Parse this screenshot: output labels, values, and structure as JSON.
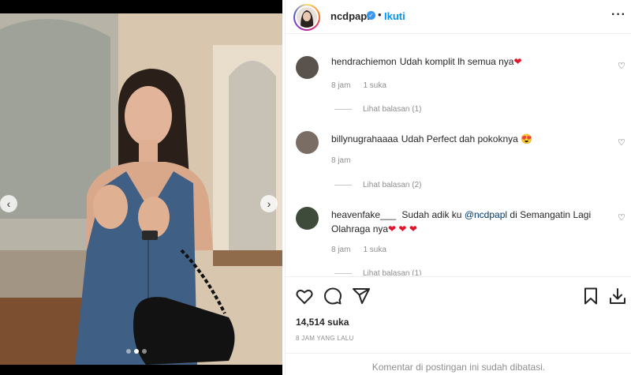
{
  "post": {
    "username": "ncdpapl",
    "follow_label": "Ikuti",
    "separator": "•",
    "more_icon": "more-horizontal-icon",
    "likes_text": "14,514 suka",
    "time_ago": "8 JAM YANG LALU",
    "comments_closed": "Komentar di postingan ini sudah dibatasi."
  },
  "carousel": {
    "prev_glyph": "‹",
    "next_glyph": "›",
    "slide_count": 3,
    "active_slide": 2
  },
  "comments": [
    {
      "username": "hendrachiemon",
      "text": "Udah komplit lh semua nya",
      "emoji": "❤",
      "time": "8 jam",
      "likes": "1 suka",
      "replies": "Lihat balasan (1)"
    },
    {
      "username": "billynugrahaaaa",
      "text": "Udah Perfect dah pokoknya",
      "emoji": "😍",
      "time": "8 jam",
      "likes": "",
      "replies": "Lihat balasan (2)"
    },
    {
      "username": "heavenfake___",
      "text_before": "Sudah adik ku",
      "mention": "@ncdpapl",
      "text_after": "di Semangatin Lagi Olahraga nya",
      "emoji": "❤ ❤ ❤",
      "time": "8 jam",
      "likes": "1 suka",
      "replies": "Lihat balasan (1)"
    }
  ],
  "icons": {
    "like": "heart-icon",
    "comment": "comment-icon",
    "share": "share-icon",
    "save": "bookmark-icon",
    "download": "download-icon"
  },
  "colors": {
    "accent": "#0095f6",
    "verified": "#3897f0",
    "heart": "#e0152a",
    "muted": "#8e8e8e"
  }
}
